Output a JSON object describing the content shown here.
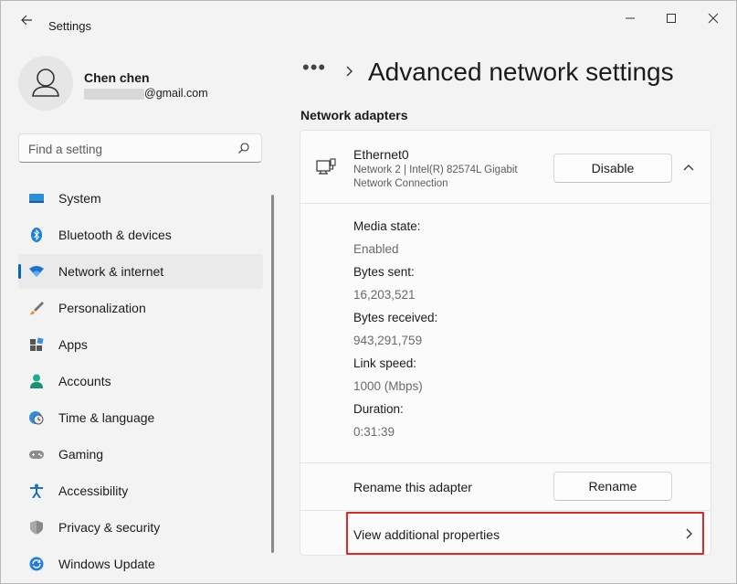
{
  "window": {
    "app_title": "Settings"
  },
  "profile": {
    "name": "Chen chen",
    "email_suffix": "@gmail.com"
  },
  "search": {
    "placeholder": "Find a setting"
  },
  "sidebar": {
    "items": [
      {
        "label": "System",
        "icon": "system-icon",
        "active": false
      },
      {
        "label": "Bluetooth & devices",
        "icon": "bluetooth-icon",
        "active": false
      },
      {
        "label": "Network & internet",
        "icon": "wifi-icon",
        "active": true
      },
      {
        "label": "Personalization",
        "icon": "paintbrush-icon",
        "active": false
      },
      {
        "label": "Apps",
        "icon": "apps-icon",
        "active": false
      },
      {
        "label": "Accounts",
        "icon": "person-icon",
        "active": false
      },
      {
        "label": "Time & language",
        "icon": "globe-clock-icon",
        "active": false
      },
      {
        "label": "Gaming",
        "icon": "gamepad-icon",
        "active": false
      },
      {
        "label": "Accessibility",
        "icon": "accessibility-icon",
        "active": false
      },
      {
        "label": "Privacy & security",
        "icon": "shield-icon",
        "active": false
      },
      {
        "label": "Windows Update",
        "icon": "update-icon",
        "active": false
      }
    ]
  },
  "breadcrumb": {
    "more": "•••",
    "title": "Advanced network settings"
  },
  "section": {
    "title": "Network adapters"
  },
  "adapter": {
    "name": "Ethernet0",
    "description": "Network 2 | Intel(R) 82574L Gigabit Network Connection",
    "disable_label": "Disable",
    "details": [
      {
        "label": "Media state:",
        "value": "Enabled"
      },
      {
        "label": "Bytes sent:",
        "value": "16,203,521"
      },
      {
        "label": "Bytes received:",
        "value": "943,291,759"
      },
      {
        "label": "Link speed:",
        "value": "1000 (Mbps)"
      },
      {
        "label": "Duration:",
        "value": "0:31:39"
      }
    ],
    "rename_label": "Rename this adapter",
    "rename_button": "Rename",
    "view_properties_label": "View additional properties"
  },
  "colors": {
    "accent": "#0067c0",
    "highlight": "#e12626",
    "background": "#f3f3f3",
    "card": "#fbfbfb"
  }
}
